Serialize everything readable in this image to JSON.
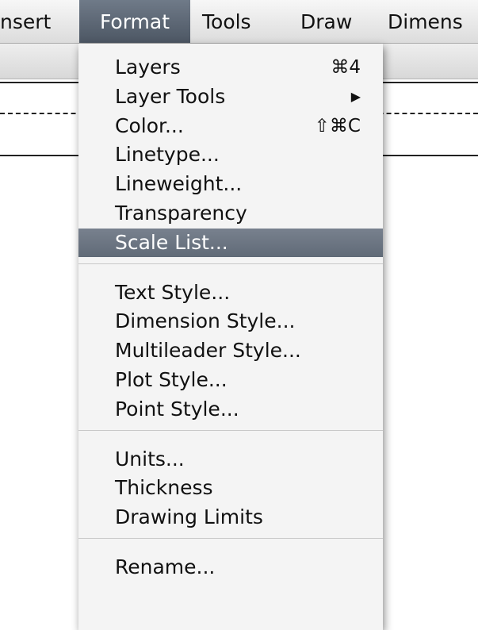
{
  "menubar": {
    "items": [
      {
        "label": "nsert"
      },
      {
        "label": "Format"
      },
      {
        "label": "Tools"
      },
      {
        "label": "Draw"
      },
      {
        "label": "Dimens"
      }
    ]
  },
  "format_menu": {
    "groups": [
      [
        {
          "label": "Layers",
          "shortcut": "⌘4"
        },
        {
          "label": "Layer Tools",
          "submenu": "▶"
        },
        {
          "label": "Color...",
          "shortcut": "⇧⌘C"
        },
        {
          "label": "Linetype..."
        },
        {
          "label": "Lineweight..."
        },
        {
          "label": "Transparency"
        },
        {
          "label": "Scale List...",
          "highlighted": true
        }
      ],
      [
        {
          "label": "Text Style..."
        },
        {
          "label": "Dimension Style..."
        },
        {
          "label": "Multileader Style..."
        },
        {
          "label": "Plot Style..."
        },
        {
          "label": "Point Style..."
        }
      ],
      [
        {
          "label": "Units..."
        },
        {
          "label": "Thickness"
        },
        {
          "label": "Drawing Limits"
        }
      ],
      [
        {
          "label": "Rename..."
        }
      ]
    ]
  },
  "colors": {
    "active_menu": "#56606c",
    "highlight": "#6b7481",
    "menu_bg": "#f4f4f4"
  }
}
